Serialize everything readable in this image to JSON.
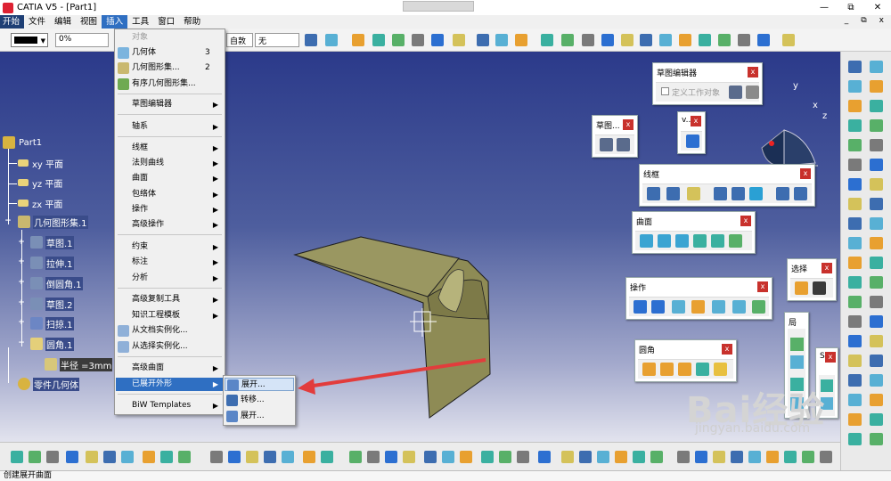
{
  "window": {
    "title": "CATIA V5 - [Part1]",
    "buttons": [
      "—",
      "⧉",
      "✕"
    ]
  },
  "menubar": {
    "items": [
      "开始",
      "文件",
      "编辑",
      "视图",
      "插入",
      "工具",
      "窗口",
      "帮助"
    ],
    "window_controls": [
      "_",
      "⧉",
      "x"
    ]
  },
  "toolbar": {
    "line_color": "#000000",
    "transparency": "0%",
    "linetype_select": "自敦",
    "layer_select": "无"
  },
  "tree": {
    "root": "Part1",
    "planes": [
      "xy 平面",
      "yz 平面",
      "zx 平面"
    ],
    "geometric_set": "几何图形集.1",
    "children": [
      "草图.1",
      "拉伸.1",
      "倒圆角.1",
      "草图.2",
      "扫掠.1",
      "圆角.1"
    ],
    "parameter": "半径 =3mm",
    "body": "零件几何体"
  },
  "insert_menu": {
    "items": [
      {
        "label": "对象",
        "disabled": true
      },
      {
        "label": "几何体",
        "accel": "3"
      },
      {
        "label": "几何图形集...",
        "accel": "2"
      },
      {
        "label": "有序几何图形集..."
      },
      {
        "label": "草图编辑器",
        "submenu": true
      },
      {
        "label": "轴系",
        "submenu": true
      },
      {
        "label": "线框",
        "submenu": true
      },
      {
        "label": "法则曲线",
        "submenu": true
      },
      {
        "label": "曲面",
        "submenu": true
      },
      {
        "label": "包络体",
        "submenu": true
      },
      {
        "label": "操作",
        "submenu": true
      },
      {
        "label": "高级操作",
        "submenu": true
      },
      {
        "label": "约束",
        "submenu": true
      },
      {
        "label": "标注",
        "submenu": true
      },
      {
        "label": "分析",
        "submenu": true
      },
      {
        "label": "高级复制工具",
        "submenu": true
      },
      {
        "label": "知识工程模板",
        "submenu": true
      },
      {
        "label": "从文档实例化..."
      },
      {
        "label": "从选择实例化..."
      },
      {
        "label": "高级曲面",
        "submenu": true
      },
      {
        "label": "已展开外形",
        "submenu": true
      },
      {
        "label": "BiW Templates",
        "submenu": true
      }
    ]
  },
  "submenu": {
    "items": [
      "展开...",
      "转移...",
      "展开..."
    ]
  },
  "palettes": {
    "sketcher": {
      "title": "草图编辑器",
      "checkbox": "定义工作对象"
    },
    "sketch_small": {
      "title": "草图..."
    },
    "v": {
      "title": "v..."
    },
    "wireframe": {
      "title": "线框"
    },
    "surfaces": {
      "title": "曲面"
    },
    "operations": {
      "title": "操作"
    },
    "fillets": {
      "title": "圆角"
    },
    "select": {
      "title": "选择"
    },
    "vertical1": {
      "title": "局"
    },
    "vertical2": {
      "title": "S"
    }
  },
  "compass": {
    "x": "x",
    "y": "y",
    "z": "z"
  },
  "status": {
    "text": "创建展开曲面"
  },
  "watermark": {
    "brand": "Bai经验",
    "url": "jingyan.baidu.com"
  },
  "colors": {
    "menu_highlight": "#2f6fc2",
    "part_surface": "#8e8b55",
    "arrow": "#e23c3c"
  }
}
